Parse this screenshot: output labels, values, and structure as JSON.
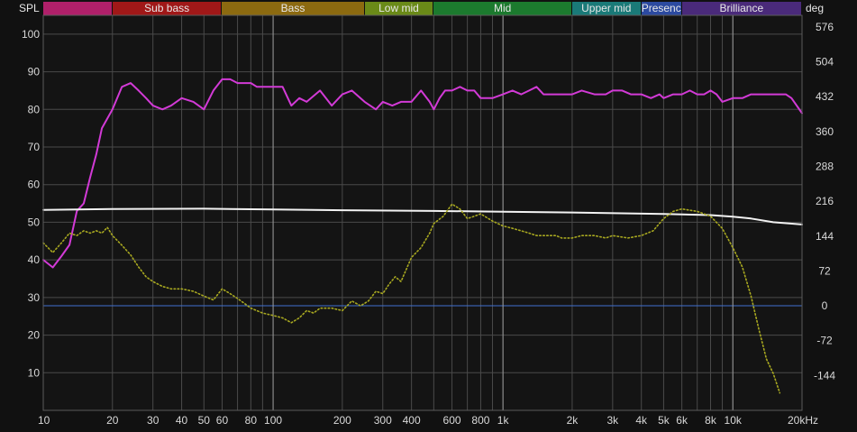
{
  "chart_data": {
    "type": "line",
    "title": "",
    "ylabel": "SPL",
    "y2label": "deg",
    "xunit": "kHz",
    "xscale": "log",
    "xlim": [
      10,
      20000
    ],
    "ylim": [
      0,
      105
    ],
    "y2lim": [
      -216,
      600
    ],
    "xticks": [
      10,
      20,
      30,
      40,
      50,
      60,
      80,
      100,
      200,
      300,
      400,
      600,
      800,
      1000,
      2000,
      3000,
      4000,
      5000,
      6000,
      8000,
      10000,
      20000
    ],
    "xtick_labels": [
      "10",
      "20",
      "30",
      "40",
      "50",
      "60",
      "80",
      "100",
      "200",
      "300",
      "400",
      "600",
      "800",
      "1k",
      "2k",
      "3k",
      "4k",
      "5k",
      "6k",
      "8k",
      "10k",
      "20kHz"
    ],
    "yticks": [
      10,
      20,
      30,
      40,
      50,
      60,
      70,
      80,
      90,
      100
    ],
    "ytick_labels": [
      "10",
      "20",
      "30",
      "40",
      "50",
      "60",
      "70",
      "80",
      "90",
      "100"
    ],
    "y2ticks": [
      -144,
      -72,
      0,
      72,
      144,
      216,
      288,
      360,
      432,
      504,
      576
    ],
    "y2tick_labels": [
      "-144",
      "-72",
      "0",
      "72",
      "144",
      "216",
      "288",
      "360",
      "432",
      "504",
      "576"
    ],
    "grid": true,
    "bands": [
      {
        "label": "",
        "from": 10,
        "to": 20,
        "color": "#b0206a"
      },
      {
        "label": "Sub bass",
        "from": 20,
        "to": 60,
        "color": "#a01818"
      },
      {
        "label": "Bass",
        "from": 60,
        "to": 250,
        "color": "#8c6a10"
      },
      {
        "label": "Low mid",
        "from": 250,
        "to": 500,
        "color": "#6a8a18"
      },
      {
        "label": "Mid",
        "from": 500,
        "to": 2000,
        "color": "#1c7a2e"
      },
      {
        "label": "Upper mid",
        "from": 2000,
        "to": 4000,
        "color": "#1a7a78"
      },
      {
        "label": "Presence",
        "from": 4000,
        "to": 6000,
        "color": "#2c4aa0"
      },
      {
        "label": "Brilliance",
        "from": 6000,
        "to": 20000,
        "color": "#4a2a7a"
      }
    ],
    "reference_lines": [
      {
        "axis": "y2",
        "value": 0,
        "color": "#3f6fd0"
      },
      {
        "axis": "x",
        "value": 100,
        "color": "#9a9a9a"
      },
      {
        "axis": "x",
        "value": 1000,
        "color": "#9a9a9a"
      },
      {
        "axis": "x",
        "value": 10000,
        "color": "#9a9a9a"
      }
    ],
    "series": [
      {
        "axis": "y",
        "color": "#d23ad6",
        "style": "solid",
        "x": [
          10,
          11,
          12,
          13,
          14,
          15,
          16,
          17,
          18,
          20,
          22,
          24,
          26,
          28,
          30,
          33,
          36,
          40,
          45,
          50,
          55,
          60,
          65,
          70,
          75,
          80,
          85,
          90,
          100,
          110,
          120,
          130,
          140,
          160,
          180,
          200,
          220,
          250,
          280,
          300,
          330,
          360,
          400,
          440,
          480,
          500,
          530,
          560,
          600,
          650,
          700,
          750,
          800,
          900,
          1000,
          1100,
          1200,
          1300,
          1400,
          1500,
          1700,
          1800,
          2000,
          2200,
          2500,
          2800,
          3000,
          3300,
          3600,
          4000,
          4400,
          4800,
          5000,
          5500,
          6000,
          6500,
          7000,
          7500,
          8000,
          8500,
          9000,
          10000,
          11000,
          12000,
          13000,
          14000,
          15000,
          16000,
          17000,
          18000,
          20000
        ],
        "values": [
          40,
          38,
          41,
          44,
          53,
          55,
          62,
          68,
          75,
          80,
          86,
          87,
          85,
          83,
          81,
          80,
          81,
          83,
          82,
          80,
          85,
          88,
          88,
          87,
          87,
          87,
          86,
          86,
          86,
          86,
          81,
          83,
          82,
          85,
          81,
          84,
          85,
          82,
          80,
          82,
          81,
          82,
          82,
          85,
          82,
          80,
          83,
          85,
          85,
          86,
          85,
          85,
          83,
          83,
          84,
          85,
          84,
          85,
          86,
          84,
          84,
          84,
          84,
          85,
          84,
          84,
          85,
          85,
          84,
          84,
          83,
          84,
          83,
          84,
          84,
          85,
          84,
          84,
          85,
          84,
          82,
          83,
          83,
          84,
          84,
          84,
          84,
          84,
          84,
          83,
          79
        ]
      },
      {
        "axis": "y",
        "color": "#f2f2f2",
        "style": "solid",
        "x": [
          10,
          20,
          50,
          100,
          200,
          500,
          1000,
          2000,
          5000,
          8000,
          10000,
          12000,
          15000,
          20000
        ],
        "values": [
          53.3,
          53.5,
          53.6,
          53.4,
          53.2,
          53.0,
          52.8,
          52.6,
          52.2,
          51.9,
          51.5,
          51.0,
          50.0,
          49.4
        ]
      },
      {
        "axis": "y2",
        "color": "#a8a820",
        "style": "dotted",
        "x": [
          10,
          11,
          12,
          13,
          14,
          15,
          16,
          17,
          18,
          19,
          20,
          22,
          24,
          26,
          28,
          30,
          33,
          36,
          40,
          45,
          50,
          55,
          60,
          65,
          70,
          75,
          80,
          90,
          100,
          110,
          120,
          130,
          140,
          150,
          160,
          180,
          200,
          220,
          240,
          260,
          280,
          300,
          320,
          340,
          360,
          400,
          440,
          480,
          500,
          550,
          600,
          650,
          700,
          750,
          800,
          900,
          1000,
          1100,
          1200,
          1300,
          1400,
          1500,
          1700,
          1800,
          2000,
          2200,
          2500,
          2800,
          3000,
          3500,
          4000,
          4500,
          5000,
          5500,
          6000,
          7000,
          8000,
          9000,
          10000,
          11000,
          12000,
          13000,
          14000,
          15000,
          16000
        ],
        "values": [
          130,
          110,
          130,
          150,
          145,
          155,
          150,
          155,
          150,
          162,
          145,
          125,
          105,
          80,
          60,
          50,
          40,
          35,
          35,
          30,
          20,
          12,
          35,
          25,
          15,
          5,
          -5,
          -15,
          -20,
          -25,
          -35,
          -25,
          -10,
          -15,
          -5,
          -5,
          -10,
          10,
          0,
          10,
          30,
          25,
          45,
          60,
          50,
          100,
          120,
          150,
          170,
          185,
          210,
          200,
          180,
          185,
          190,
          175,
          165,
          160,
          155,
          150,
          145,
          145,
          145,
          140,
          140,
          145,
          145,
          140,
          145,
          140,
          145,
          155,
          180,
          195,
          200,
          195,
          185,
          160,
          120,
          80,
          20,
          -50,
          -110,
          -140,
          -180
        ]
      }
    ]
  }
}
